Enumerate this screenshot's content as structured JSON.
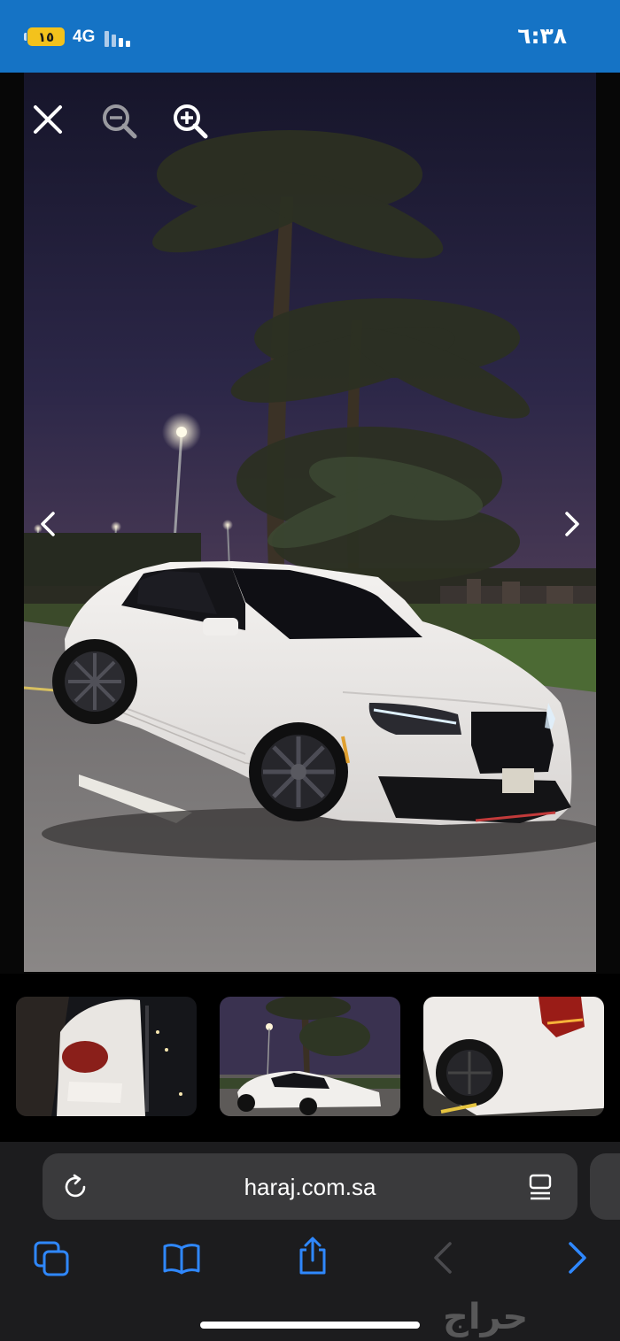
{
  "status_bar": {
    "battery_level": "١٥",
    "network": "4G",
    "time": "٦:٣٨",
    "background_color": "#1573c5",
    "battery_color": "#f3c21c"
  },
  "viewer": {
    "icons": [
      "close-icon",
      "zoom-out-icon",
      "zoom-in-icon",
      "chevron-left-icon",
      "chevron-right-icon"
    ]
  },
  "thumbnails": [
    {
      "name": "thumbnail-car-rear-night"
    },
    {
      "name": "thumbnail-car-front-palms"
    },
    {
      "name": "thumbnail-car-rear-wheel"
    }
  ],
  "safari": {
    "url": "haraj.com.sa",
    "accent_color": "#2f88ff",
    "icons": [
      "reload-icon",
      "reader-icon",
      "tabs-icon",
      "bookmarks-icon",
      "share-icon",
      "back-icon",
      "forward-icon"
    ]
  },
  "watermark": {
    "text": "حراج"
  }
}
